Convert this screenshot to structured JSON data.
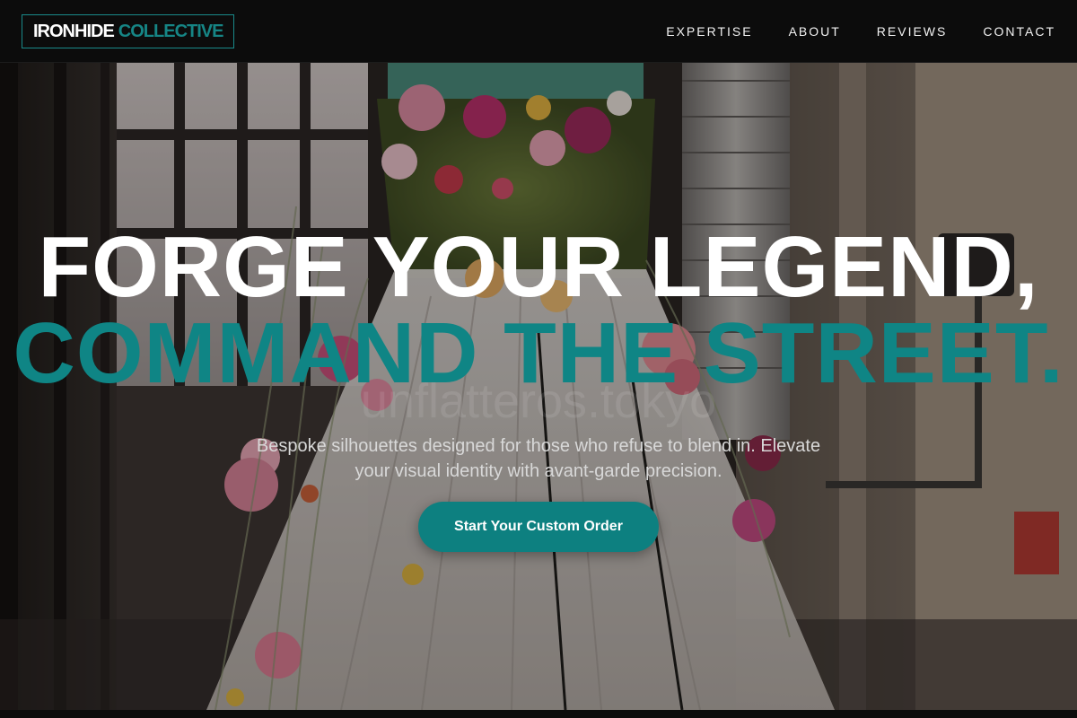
{
  "brand": {
    "name_part1": "IRONHIDE",
    "name_part2": "COLLECTIVE",
    "accent_color": "#0f8585"
  },
  "nav": {
    "items": [
      {
        "label": "EXPERTISE"
      },
      {
        "label": "ABOUT"
      },
      {
        "label": "REVIEWS"
      },
      {
        "label": "CONTACT"
      }
    ]
  },
  "hero": {
    "headline_line1": "FORGE YOUR LEGEND,",
    "headline_line2": "COMMAND THE STREET.",
    "watermark": "unflatteros.tokyo",
    "subtitle": "Bespoke silhouettes designed for those who refuse to blend in. Elevate your visual identity with avant-garde precision.",
    "cta_label": "Start Your Custom Order",
    "background_image": "flower-adorned-dress-on-mannequin"
  }
}
